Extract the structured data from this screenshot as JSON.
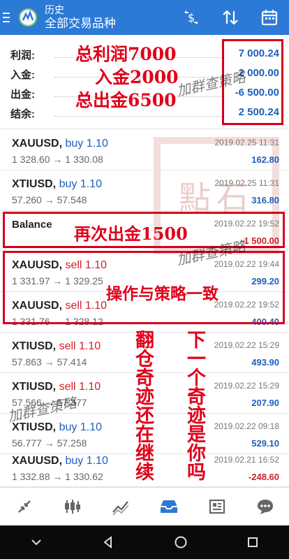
{
  "header": {
    "title": "历史",
    "subtitle": "全部交易品种"
  },
  "summary": [
    {
      "label": "利润:",
      "value": "7 000.24"
    },
    {
      "label": "入金:",
      "value": "2 000.00"
    },
    {
      "label": "出金:",
      "value": "-6 500.00"
    },
    {
      "label": "结余:",
      "value": "2 500.24"
    }
  ],
  "deals": [
    {
      "symbol": "XAUUSD,",
      "action": "buy 1.10",
      "dir": "buy",
      "prices": "1 328.60 → 1 330.08",
      "date": "2019.02.25 11:31",
      "pl": "162.80",
      "plClass": "pos"
    },
    {
      "symbol": "XTIUSD,",
      "action": "buy 1.10",
      "dir": "buy",
      "prices": "57.260 → 57.548",
      "date": "2019.02.25 11:31",
      "pl": "316.80",
      "plClass": "pos"
    },
    {
      "symbol": "Balance",
      "action": "",
      "dir": "buy",
      "prices": "",
      "date": "2019.02.22 19:52",
      "pl": "-1 500.00",
      "plClass": "neg"
    },
    {
      "symbol": "XAUUSD,",
      "action": "sell 1.10",
      "dir": "sell",
      "prices": "1 331.97 → 1 329.25",
      "date": "2019.02.22 19:44",
      "pl": "299.20",
      "plClass": "pos"
    },
    {
      "symbol": "XAUUSD,",
      "action": "sell 1.10",
      "dir": "sell",
      "prices": "1 331.76 → 1 328.12",
      "date": "2019.02.22 19:52",
      "pl": "400.40",
      "plClass": "pos"
    },
    {
      "symbol": "XTIUSD,",
      "action": "sell 1.10",
      "dir": "sell",
      "prices": "57.863 → 57.414",
      "date": "2019.02.22 15:29",
      "pl": "493.90",
      "plClass": "pos"
    },
    {
      "symbol": "XTIUSD,",
      "action": "sell 1.10",
      "dir": "sell",
      "prices": "57.566 → 57.377",
      "date": "2019.02.22 15:29",
      "pl": "207.90",
      "plClass": "pos"
    },
    {
      "symbol": "XTIUSD,",
      "action": "buy 1.10",
      "dir": "buy",
      "prices": "56.777 → 57.258",
      "date": "2019.02.22 09:18",
      "pl": "529.10",
      "plClass": "pos"
    },
    {
      "symbol": "XAUUSD,",
      "action": "buy 1.10",
      "dir": "buy",
      "prices": "1 332.88 → 1 330.62",
      "date": "2019.02.21 16:52",
      "pl": "-248.60",
      "plClass": "neg"
    }
  ],
  "annotations": {
    "profit": "总利润7000",
    "deposit": "入金2000",
    "withdraw": "总出金6500",
    "again": "再次出金1500",
    "consistent": "操作与策略一致",
    "col_a": "翻仓奇迹还在继续",
    "col_b": "下一个奇迹是你吗"
  },
  "stamp_text": "點石",
  "signature_text": "加群查策略",
  "colors": {
    "appbar": "#2b7ad6",
    "buy": "#1d5fbf",
    "sell": "#d41e28",
    "annotation": "#e0001a"
  },
  "icons": {
    "appbar": [
      "menu-icon",
      "metatrader-logo-icon",
      "currency-swap-icon",
      "sort-icon",
      "calendar-icon"
    ],
    "bottom": [
      "quotes-icon",
      "chart-icon",
      "trade-icon",
      "history-icon",
      "news-icon",
      "messages-icon"
    ],
    "system": [
      "back-icon",
      "home-icon",
      "recents-icon"
    ]
  }
}
